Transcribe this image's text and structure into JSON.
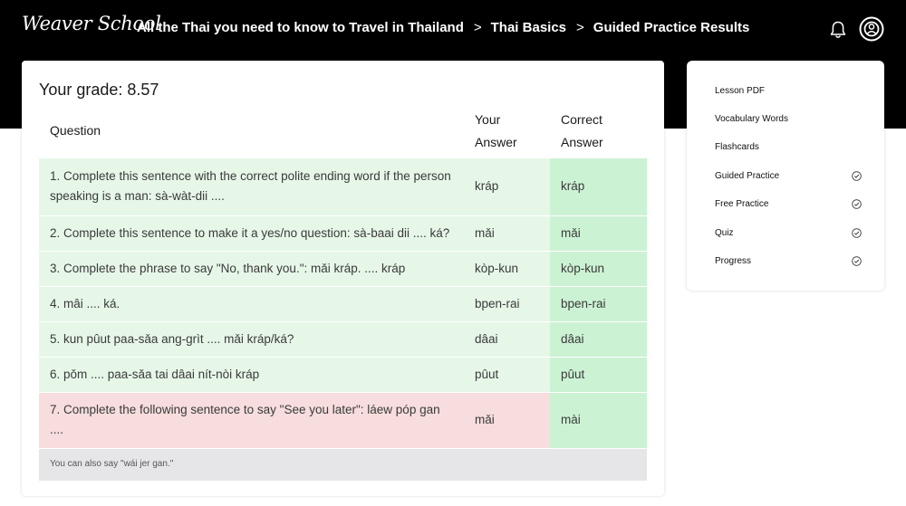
{
  "header": {
    "logo": "Weaver School",
    "breadcrumb": [
      "All the Thai you need to know to Travel in Thailand",
      "Thai Basics",
      "Guided Practice Results"
    ],
    "separator": ">",
    "icons": [
      "bell-icon",
      "user-circle-icon"
    ]
  },
  "results": {
    "grade_label": "Your grade: 8.57",
    "columns": {
      "question": "Question",
      "your_answer_line1": "Your",
      "your_answer_line2": "Answer",
      "correct_answer_line1": "Correct",
      "correct_answer_line2": "Answer"
    },
    "rows": [
      {
        "question": "1. Complete this sentence with the correct polite ending word if the person speaking is a man: sà-wàt-dii ....",
        "your_answer": "kráp",
        "correct_answer": "kráp",
        "status": "correct"
      },
      {
        "question": "2. Complete this sentence to make it a yes/no question: sà-baai dii .... ká?",
        "your_answer": "mǎi",
        "correct_answer": "mǎi",
        "status": "correct"
      },
      {
        "question": "3. Complete the phrase to say \"No, thank you.\": mǎi kráp. .... kráp",
        "your_answer": "kòp-kun",
        "correct_answer": "kòp-kun",
        "status": "correct"
      },
      {
        "question": "4. mâi .... ká.",
        "your_answer": "bpen-rai",
        "correct_answer": "bpen-rai",
        "status": "correct"
      },
      {
        "question": "5. kun pûut paa-sǎa ang-grìt .... mǎi kráp/ká?",
        "your_answer": "dâai",
        "correct_answer": "dâai",
        "status": "correct"
      },
      {
        "question": "6. pǒm .... paa-sǎa tai dâai nít-nòi kráp",
        "your_answer": "pûut",
        "correct_answer": "pûut",
        "status": "correct"
      },
      {
        "question": "7. Complete the following sentence to say \"See you later\": láew póp gan ....",
        "your_answer": "mǎi",
        "correct_answer": "mài",
        "status": "incorrect"
      }
    ],
    "note": "You can also say \"wái jer gan.\""
  },
  "sidebar": {
    "items": [
      {
        "label": "Lesson PDF",
        "checked": false
      },
      {
        "label": "Vocabulary Words",
        "checked": false
      },
      {
        "label": "Flashcards",
        "checked": false
      },
      {
        "label": "Guided Practice",
        "checked": true
      },
      {
        "label": "Free Practice",
        "checked": true
      },
      {
        "label": "Quiz",
        "checked": true
      },
      {
        "label": "Progress",
        "checked": true
      }
    ]
  },
  "colors": {
    "header_bg": "#000000",
    "correct_row": "#e6f7e8",
    "correct_answer_col": "#ccf2d4",
    "incorrect_row": "#f7dddd",
    "note_row": "#e6e6e9"
  }
}
